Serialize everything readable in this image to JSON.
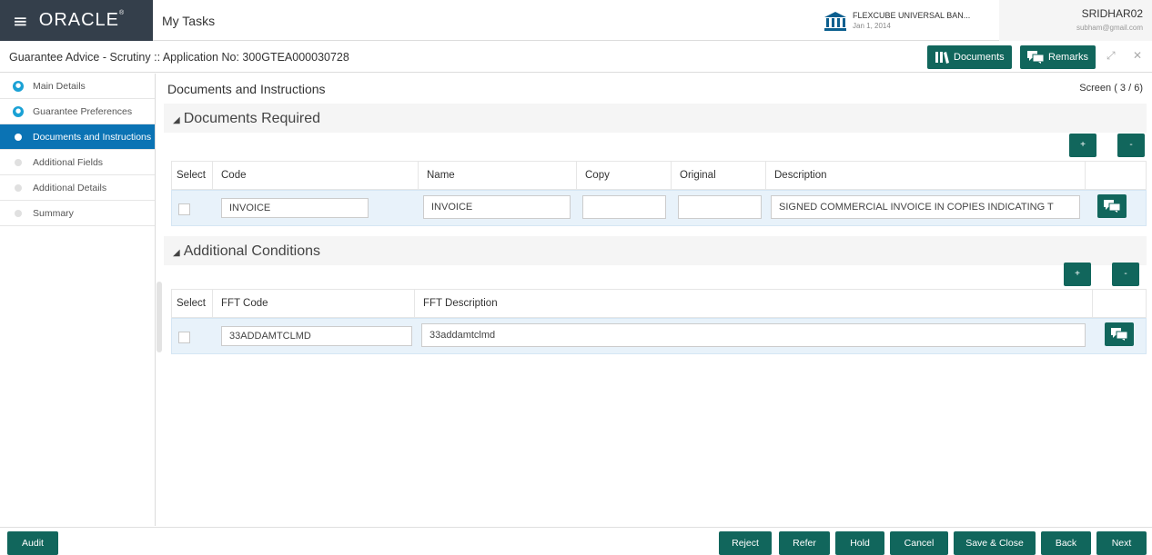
{
  "header": {
    "brand": "ORACLE",
    "brand_mark": "®",
    "menu_icon": "hamburger-icon",
    "app_title": "My Tasks",
    "entity_name": "FLEXCUBE UNIVERSAL BAN...",
    "entity_date": "Jan 1, 2014",
    "entity_icon": "bank-icon",
    "user_name": "SRIDHAR02",
    "user_email": "subham@gmail.com"
  },
  "titlebar": {
    "title": "Guarantee Advice - Scrutiny :: Application No: 300GTEA000030728",
    "documents_label": "Documents",
    "remarks_label": "Remarks",
    "minimize_icon": "minimize-icon",
    "close_icon": "close-icon"
  },
  "sidebar": {
    "items": [
      {
        "label": "Main Details",
        "state": "done"
      },
      {
        "label": "Guarantee Preferences",
        "state": "done"
      },
      {
        "label": "Documents and Instructions",
        "state": "current"
      },
      {
        "label": "Additional Fields",
        "state": "todo"
      },
      {
        "label": "Additional Details",
        "state": "todo"
      },
      {
        "label": "Summary",
        "state": "todo"
      }
    ]
  },
  "main": {
    "section_title": "Documents and Instructions",
    "screen_indicator": "Screen ( 3 / 6)",
    "documents": {
      "title": "Documents Required",
      "add_label": "+",
      "remove_label": "-",
      "columns": [
        "Select",
        "Code",
        "Name",
        "Copy",
        "Original",
        "Description"
      ],
      "rows": [
        {
          "code": "INVOICE",
          "name": "INVOICE",
          "copy": "",
          "original": "",
          "description": "SIGNED COMMERCIAL INVOICE IN     COPIES INDICATING T"
        }
      ]
    },
    "conditions": {
      "title": "Additional Conditions",
      "add_label": "+",
      "remove_label": "-",
      "columns": [
        "Select",
        "FFT Code",
        "FFT Description"
      ],
      "rows": [
        {
          "code": "33ADDAMTCLMD",
          "description": "33addamtclmd"
        }
      ]
    }
  },
  "footer": {
    "audit": "Audit",
    "reject": "Reject",
    "refer": "Refer",
    "hold": "Hold",
    "cancel": "Cancel",
    "save_close": "Save & Close",
    "back": "Back",
    "next": "Next"
  },
  "colors": {
    "brand_bg": "#343f4b",
    "button": "#11665c",
    "active_nav": "#0b73b4",
    "row_highlight": "#e8f2fa"
  }
}
